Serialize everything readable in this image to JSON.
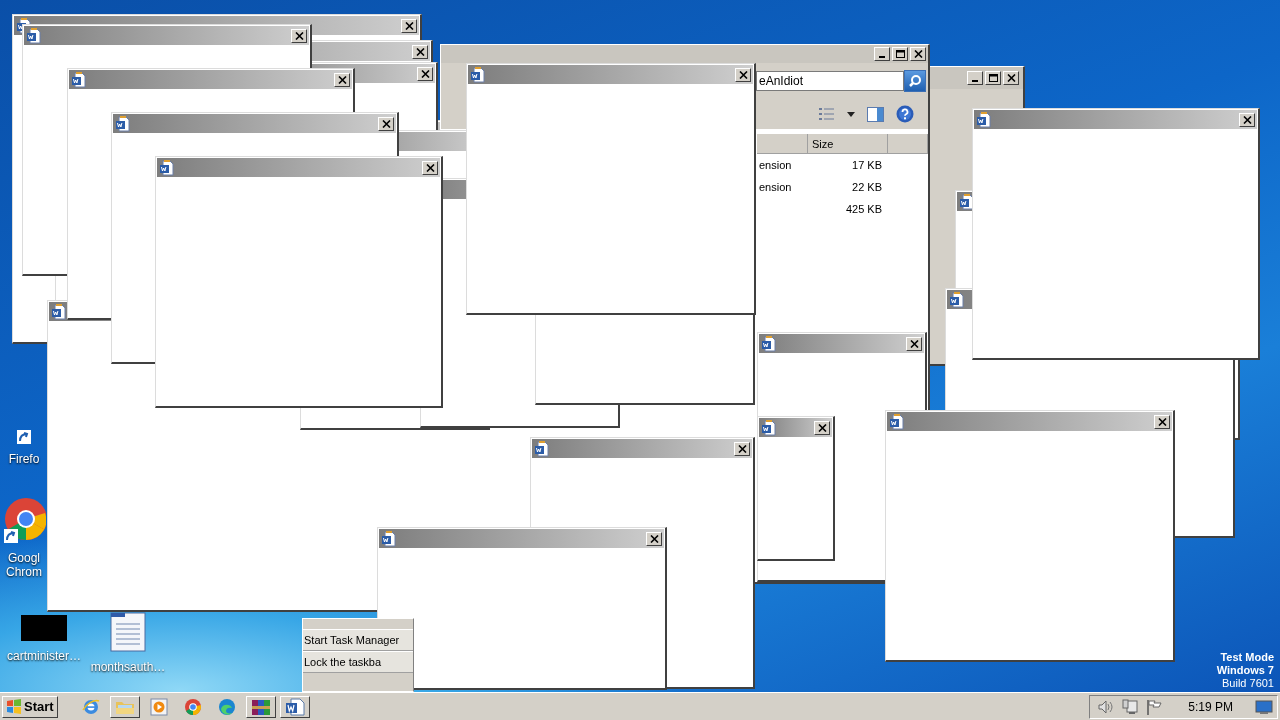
{
  "desktop_icons": [
    {
      "kind": "firefox",
      "label": "Firefo"
    },
    {
      "kind": "chrome",
      "label": "Googl Chrom"
    },
    {
      "kind": "thumbnail",
      "label": "cartminister…"
    },
    {
      "kind": "document",
      "label": "monthsauth…"
    }
  ],
  "windows": [
    {
      "kind": "popup"
    },
    {
      "kind": "popup"
    },
    {
      "kind": "popup"
    },
    {
      "kind": "popup"
    },
    {
      "kind": "popup"
    },
    {
      "kind": "window"
    },
    {
      "kind": "explorer",
      "search_value": "eAnIdiot",
      "columns": [
        "Size"
      ],
      "rows": [
        {
          "name": "ension",
          "size": "17 KB"
        },
        {
          "name": "ension",
          "size": "22 KB"
        },
        {
          "size": "425 KB"
        }
      ]
    },
    {
      "kind": "popup"
    },
    {
      "kind": "popup"
    },
    {
      "kind": "popup"
    },
    {
      "kind": "popup"
    },
    {
      "kind": "popup"
    },
    {
      "kind": "popup"
    },
    {
      "kind": "popup"
    },
    {
      "kind": "popup"
    },
    {
      "kind": "popup"
    },
    {
      "kind": "popup"
    },
    {
      "kind": "popup"
    },
    {
      "kind": "popup"
    },
    {
      "kind": "popup"
    },
    {
      "kind": "popup"
    },
    {
      "kind": "popup"
    },
    {
      "kind": "popup"
    }
  ],
  "context_menu": {
    "items": [
      {
        "label": "Start Task Manager"
      },
      {
        "label": "Lock the taskba"
      }
    ]
  },
  "watermark": [
    {
      "text": "Test Mode",
      "bold": true
    },
    {
      "text": "Windows 7",
      "bold": true
    },
    {
      "text": "Build 7601",
      "bold": false
    }
  ],
  "taskbar": {
    "start": "Start",
    "items": [
      {
        "kind": "ie",
        "running": false
      },
      {
        "kind": "folder",
        "running": true
      },
      {
        "kind": "media",
        "running": false
      },
      {
        "kind": "chrome",
        "running": false
      },
      {
        "kind": "edge",
        "running": false
      },
      {
        "kind": "winrar",
        "running": true
      },
      {
        "kind": "word",
        "running": true
      }
    ],
    "clock": "5:19 PM"
  }
}
